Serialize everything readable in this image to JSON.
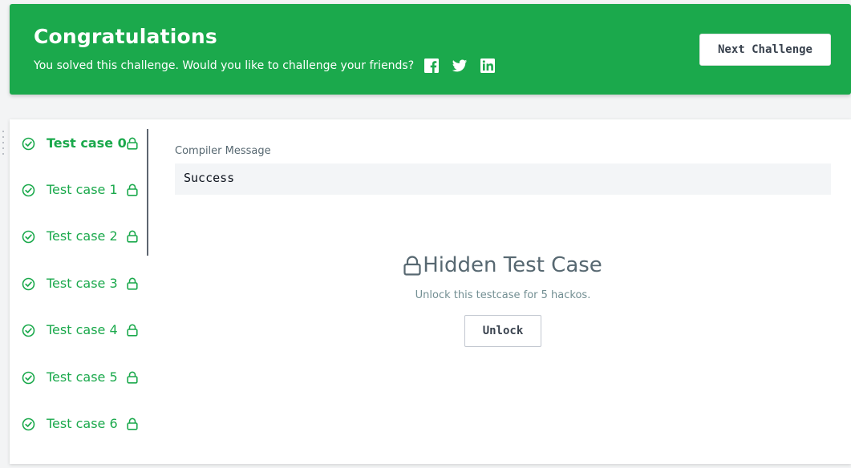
{
  "banner": {
    "title": "Congratulations",
    "subtitle": "You solved this challenge. Would you like to challenge your friends?",
    "social_icons": [
      "facebook-icon",
      "twitter-icon",
      "linkedin-icon"
    ],
    "next_button": "Next Challenge",
    "bg_color": "#1ba94c"
  },
  "testcases": [
    {
      "label": "Test case 0",
      "active": true
    },
    {
      "label": "Test case 1",
      "active": false
    },
    {
      "label": "Test case 2",
      "active": false
    },
    {
      "label": "Test case 3",
      "active": false
    },
    {
      "label": "Test case 4",
      "active": false
    },
    {
      "label": "Test case 5",
      "active": false
    },
    {
      "label": "Test case 6",
      "active": false
    }
  ],
  "compiler": {
    "label": "Compiler Message",
    "message": "Success"
  },
  "hidden": {
    "title": "Hidden Test Case",
    "subtitle": "Unlock this testcase for 5 hackos.",
    "unlock_button": "Unlock"
  },
  "colors": {
    "accent_green": "#1ba94c",
    "text_dark": "#39424e"
  }
}
